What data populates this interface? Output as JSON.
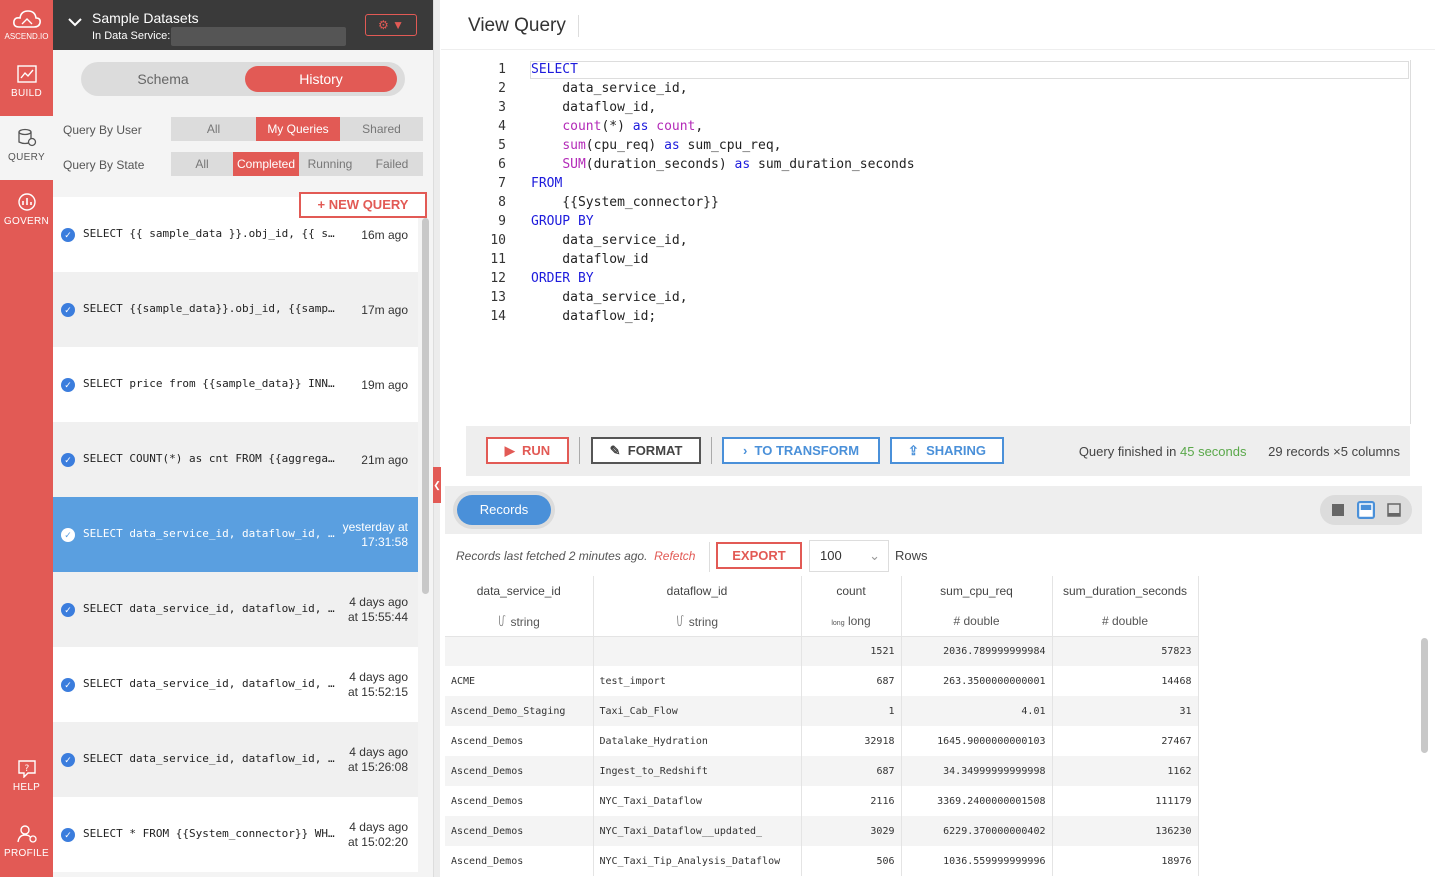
{
  "nav": {
    "logo_label": "ASCEND.IO",
    "items": [
      {
        "label": "BUILD",
        "icon": "build-icon"
      },
      {
        "label": "QUERY",
        "icon": "query-icon"
      },
      {
        "label": "GOVERN",
        "icon": "govern-icon"
      },
      {
        "label": "HELP",
        "icon": "help-icon"
      },
      {
        "label": "PROFILE",
        "icon": "profile-icon"
      }
    ]
  },
  "dataset_header": {
    "title": "Sample Datasets",
    "service_label": "In Data Service:",
    "settings_icon": "gear-icon"
  },
  "panel_tabs": {
    "schema": "Schema",
    "history": "History",
    "active": "History"
  },
  "filters": {
    "by_user_label": "Query By User",
    "user_options": [
      "All",
      "My Queries",
      "Shared"
    ],
    "user_selected": "My Queries",
    "by_state_label": "Query By State",
    "state_options": [
      "All",
      "Completed",
      "Running",
      "Failed"
    ],
    "state_selected": "Completed"
  },
  "new_query_label": "NEW QUERY",
  "history": [
    {
      "sql": "SELECT {{ sample_data }}.obj_id, {{ sample_data }}",
      "time1": "16m ago",
      "time2": ""
    },
    {
      "sql": "SELECT {{sample_data}}.obj_id, {{sample_data}}",
      "time1": "17m ago",
      "time2": ""
    },
    {
      "sql": "SELECT price from {{sample_data}} INNER JOIN",
      "time1": "19m ago",
      "time2": ""
    },
    {
      "sql": "SELECT COUNT(*) as cnt FROM {{aggregated_data}}",
      "time1": "21m ago",
      "time2": ""
    },
    {
      "sql": "SELECT data_service_id, dataflow_id, count(*)",
      "time1": "yesterday at",
      "time2": "17:31:58"
    },
    {
      "sql": "SELECT data_service_id, dataflow_id, count(*)",
      "time1": "4 days ago",
      "time2": "at 15:55:44"
    },
    {
      "sql": "SELECT data_service_id, dataflow_id, sum(cpu_req)",
      "time1": "4 days ago",
      "time2": "at 15:52:15"
    },
    {
      "sql": "SELECT data_service_id, dataflow_id, sum(cpu_req)",
      "time1": "4 days ago",
      "time2": "at 15:26:08"
    },
    {
      "sql": "SELECT * FROM {{System_connector}} WHERE",
      "time1": "4 days ago",
      "time2": "at 15:02:20"
    }
  ],
  "view_query": {
    "title": "View Query",
    "line_numbers": [
      "1",
      "2",
      "3",
      "4",
      "5",
      "6",
      "7",
      "8",
      "9",
      "10",
      "11",
      "12",
      "13",
      "14"
    ]
  },
  "toolbar": {
    "run": "RUN",
    "format": "FORMAT",
    "to_transform": "TO TRANSFORM",
    "sharing": "SHARING",
    "status_prefix": "Query finished in",
    "status_time": "45 seconds",
    "records_summary": "29 records ×5 columns"
  },
  "results": {
    "records_tab": "Records",
    "fetched_text": "Records last fetched 2 minutes ago.",
    "refetch": "Refetch",
    "export": "EXPORT",
    "rows_value": "100",
    "rows_label": "Rows",
    "columns": [
      {
        "name": "data_service_id",
        "type": "string"
      },
      {
        "name": "dataflow_id",
        "type": "string"
      },
      {
        "name": "count",
        "type": "long"
      },
      {
        "name": "sum_cpu_req",
        "type": "double"
      },
      {
        "name": "sum_duration_seconds",
        "type": "double"
      }
    ],
    "rows": [
      [
        "",
        "",
        "1521",
        "2036.789999999984",
        "57823"
      ],
      [
        "ACME",
        "test_import",
        "687",
        "263.3500000000001",
        "14468"
      ],
      [
        "Ascend_Demo_Staging",
        "Taxi_Cab_Flow",
        "1",
        "4.01",
        "31"
      ],
      [
        "Ascend_Demos",
        "Datalake_Hydration",
        "32918",
        "1645.9000000000103",
        "27467"
      ],
      [
        "Ascend_Demos",
        "Ingest_to_Redshift",
        "687",
        "34.34999999999998",
        "1162"
      ],
      [
        "Ascend_Demos",
        "NYC_Taxi_Dataflow",
        "2116",
        "3369.2400000001508",
        "111179"
      ],
      [
        "Ascend_Demos",
        "NYC_Taxi_Dataflow__updated_",
        "3029",
        "6229.370000000402",
        "136230"
      ],
      [
        "Ascend_Demos",
        "NYC_Taxi_Tip_Analysis_Dataflow",
        "506",
        "1036.559999999996",
        "18976"
      ]
    ]
  },
  "colors": {
    "accent": "#e25a55",
    "blue": "#4a90d9",
    "green": "#5aa84a"
  }
}
